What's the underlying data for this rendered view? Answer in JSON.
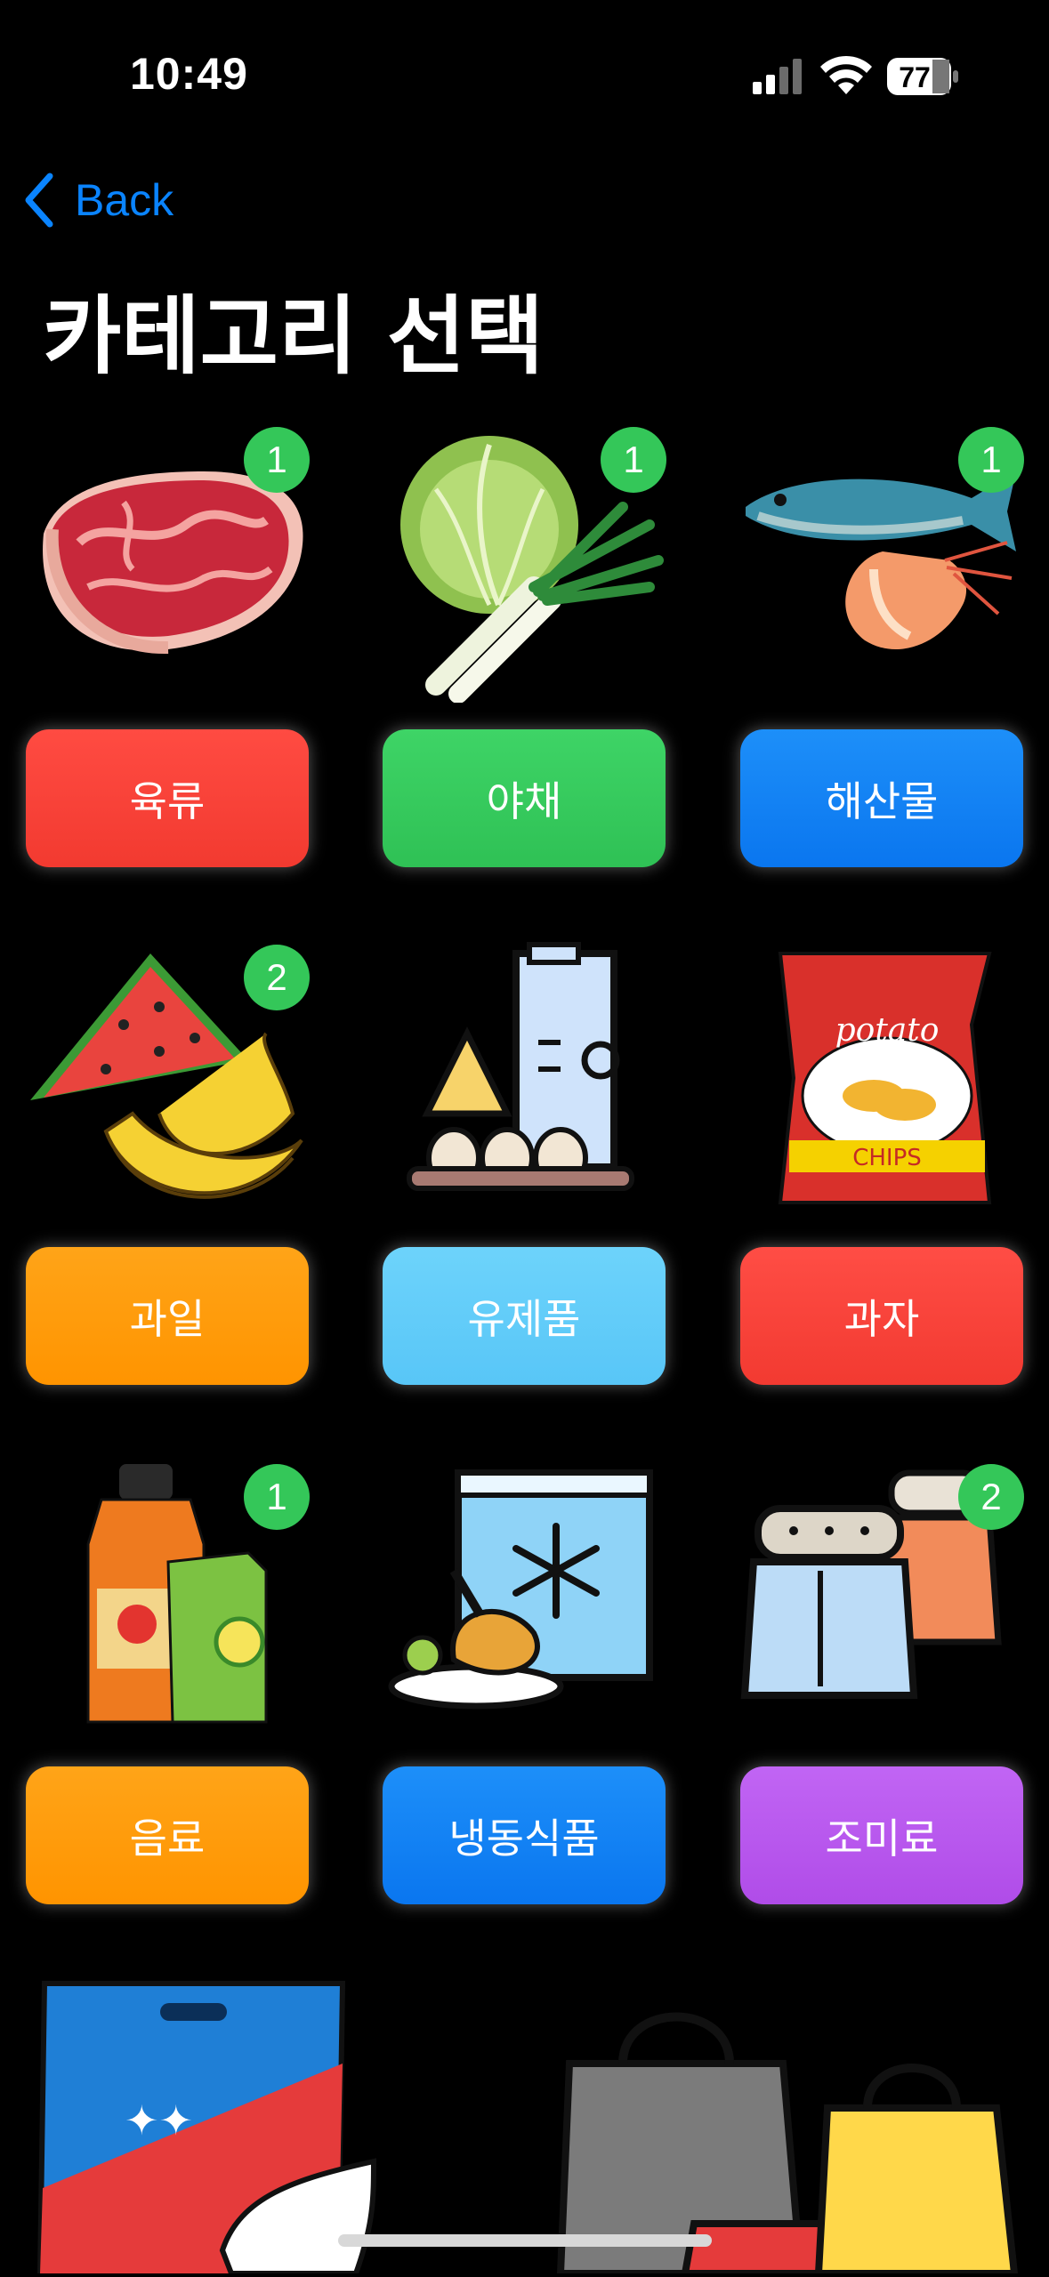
{
  "status_bar": {
    "time": "10:49",
    "battery": "77"
  },
  "nav": {
    "back_label": "Back"
  },
  "page": {
    "title": "카테고리 선택"
  },
  "categories": [
    {
      "label": "육류",
      "badge": "1",
      "color": "#ff3b30",
      "icon": "meat-steak-icon"
    },
    {
      "label": "야채",
      "badge": "1",
      "color": "#34c759",
      "icon": "cabbage-leek-icon"
    },
    {
      "label": "해산물",
      "badge": "1",
      "color": "#0a84ff",
      "icon": "fish-shrimp-icon"
    },
    {
      "label": "과일",
      "badge": "2",
      "color": "#ff9f0a",
      "icon": "watermelon-banana-icon"
    },
    {
      "label": "유제품",
      "badge": "",
      "color": "#5ac8fa",
      "icon": "milk-cheese-eggs-icon"
    },
    {
      "label": "과자",
      "badge": "",
      "color": "#ff453a",
      "icon": "potato-chips-icon"
    },
    {
      "label": "음료",
      "badge": "1",
      "color": "#ff9f0a",
      "icon": "juice-bottles-icon"
    },
    {
      "label": "냉동식품",
      "badge": "",
      "color": "#0a84ff",
      "icon": "frozen-food-icon"
    },
    {
      "label": "조미료",
      "badge": "2",
      "color": "#bf5af2",
      "icon": "spice-jars-icon"
    }
  ],
  "chips_bag_text": [
    "potato",
    "CHIPS"
  ]
}
